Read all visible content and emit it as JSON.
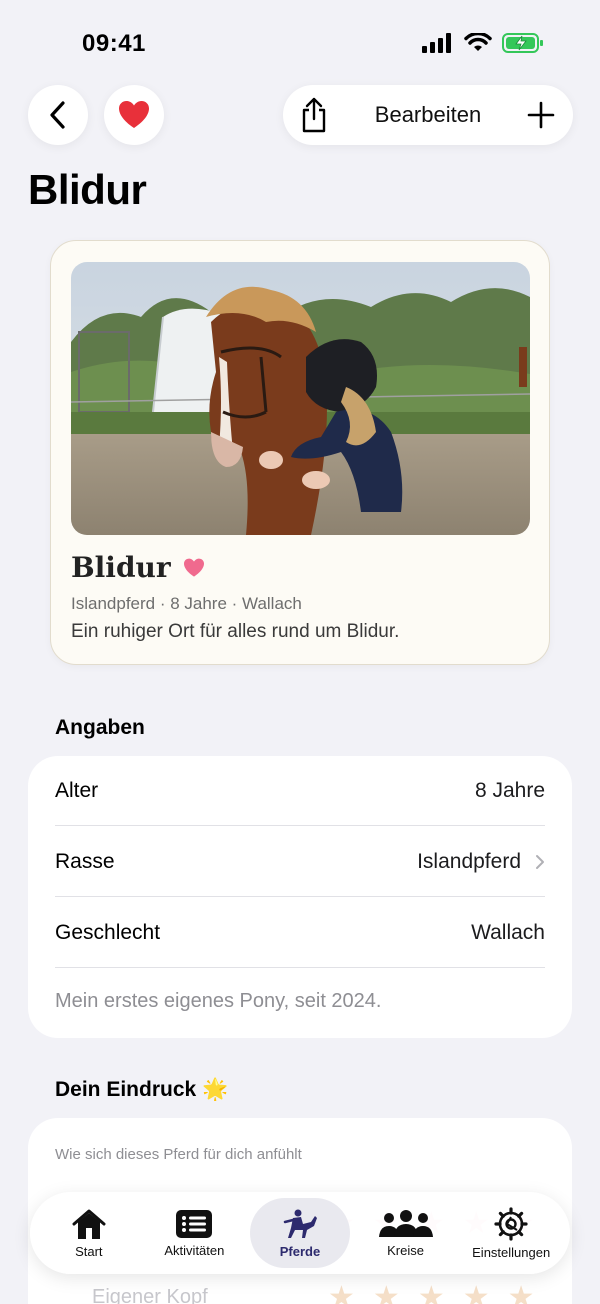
{
  "status_bar": {
    "time": "09:41"
  },
  "nav": {
    "edit_label": "Bearbeiten"
  },
  "page": {
    "title": "Blidur"
  },
  "profile": {
    "name": "Blidur",
    "meta": "Islandpferd · 8 Jahre · Wallach",
    "description": "Ein ruhiger Ort für alles rund um Blidur."
  },
  "details": {
    "title": "Angaben",
    "rows": [
      {
        "label": "Alter",
        "value": "8 Jahre"
      },
      {
        "label": "Rasse",
        "value": "Islandpferd"
      },
      {
        "label": "Geschlecht",
        "value": "Wallach"
      }
    ],
    "note": "Mein erstes eigenes Pony, seit 2024."
  },
  "impression": {
    "title": "Dein Eindruck 🌟",
    "subtitle": "Wie sich dieses Pferd für dich anfühlt",
    "faded_label": "Eigener Kopf"
  },
  "tabs": [
    {
      "label": "Start",
      "icon": "house-icon"
    },
    {
      "label": "Aktivitäten",
      "icon": "list-icon"
    },
    {
      "label": "Pferde",
      "icon": "horse-rider-icon",
      "active": true
    },
    {
      "label": "Kreise",
      "icon": "people-icon"
    },
    {
      "label": "Einstellungen",
      "icon": "gear-icon"
    }
  ],
  "colors": {
    "background": "#f2f2f7",
    "heart": "#e8303a",
    "heart_pink": "#f06a8e",
    "active_tab": "#2d2a6e",
    "card_cream": "#fdfbf5"
  }
}
